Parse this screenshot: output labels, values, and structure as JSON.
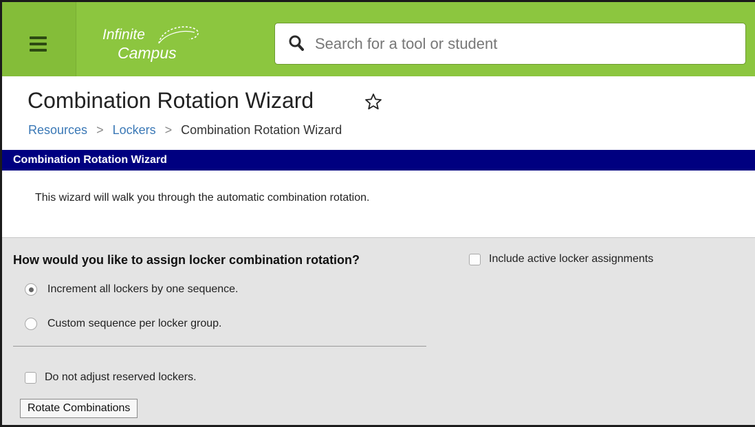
{
  "header": {
    "menu_icon": "hamburger-menu-icon",
    "logo": {
      "line1": "Infinite",
      "line2": "Campus"
    },
    "search": {
      "placeholder": "Search for a tool or student",
      "value": "",
      "icon": "search-icon"
    }
  },
  "page": {
    "title": "Combination Rotation Wizard",
    "favorite_icon": "star-outline-icon",
    "breadcrumb": [
      "Resources",
      "Lockers",
      "Combination Rotation Wizard"
    ]
  },
  "section": {
    "title": "Combination Rotation Wizard",
    "intro": "This wizard will walk you through the automatic combination rotation."
  },
  "form": {
    "question": "How would you like to assign locker combination rotation?",
    "options": [
      {
        "label": "Increment all lockers by one sequence.",
        "selected": true
      },
      {
        "label": "Custom sequence per locker group.",
        "selected": false
      }
    ],
    "include_active": {
      "label": "Include active locker assignments",
      "checked": false
    },
    "reserved": {
      "label": "Do not adjust reserved lockers.",
      "checked": false
    },
    "submit_label": "Rotate Combinations"
  },
  "colors": {
    "header_green": "#8cc63f",
    "section_navy": "#000080",
    "link_blue": "#3a78b6",
    "panel_gray": "#e4e4e4"
  }
}
